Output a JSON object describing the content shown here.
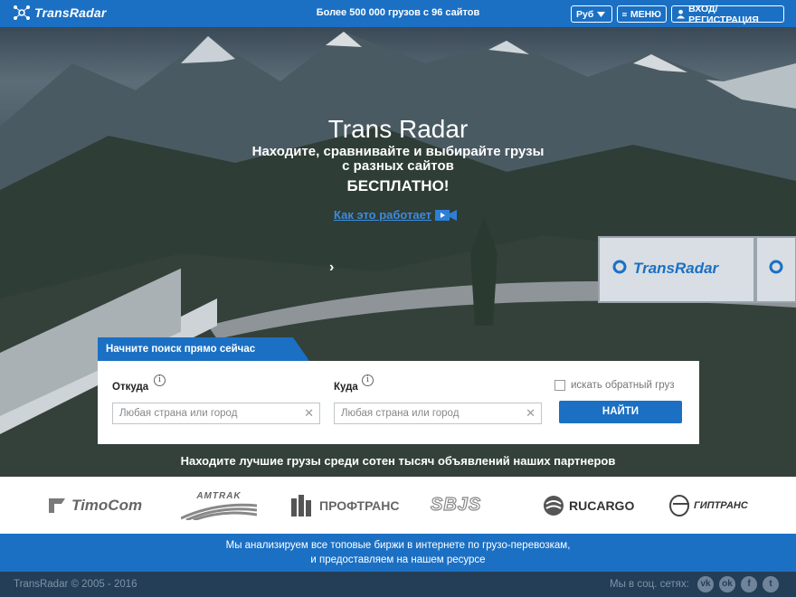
{
  "header": {
    "logo_text": "TransRadar",
    "tagline_prefix": "Более ",
    "tagline_count": "500 000",
    "tagline_mid": " грузов с ",
    "tagline_sites": "96",
    "tagline_suffix": " сайтов",
    "currency_label": "Руб",
    "menu_label": "МЕНЮ",
    "login_label": "ВХОД/РЕГИСТРАЦИЯ"
  },
  "hero": {
    "title": "Trans Radar",
    "subtitle_line1": "Находите, сравнивайте и выбирайте грузы",
    "subtitle_line2": "с разных сайтов",
    "free": "БЕСПЛАТНО!",
    "how_link": "Как это работает",
    "truck_logo_text": "TransRadar"
  },
  "search": {
    "tab_label": "Начните поиск прямо сейчас",
    "from_label": "Откуда",
    "from_placeholder": "Любая страна или город",
    "to_label": "Куда",
    "to_placeholder": "Любая страна или город",
    "reverse_label": "искать обратный груз",
    "find_button": "НАЙТИ"
  },
  "partners": {
    "caption": "Находите лучшие грузы среди сотен тысяч объявлений наших партнеров",
    "logos": [
      "TimoCom",
      "AMTRAK",
      "ПРОФТРАНС",
      "SBJS",
      "RUCARGO",
      "ГИПТРАНС"
    ]
  },
  "info": {
    "line1": "Мы анализируем все топовые биржи в интернете по грузо-перевозкам,",
    "line2": "и предоставляем на нашем ресурсе"
  },
  "footer": {
    "copyright": "TransRadar © 2005 - 2016",
    "social_label": "Мы в соц. сетях:",
    "social_icons": [
      "vk-icon",
      "odnoklassniki-icon",
      "facebook-icon",
      "twitter-icon"
    ]
  },
  "colors": {
    "brand_blue": "#1b70c4",
    "footer_bg": "#243e57"
  }
}
